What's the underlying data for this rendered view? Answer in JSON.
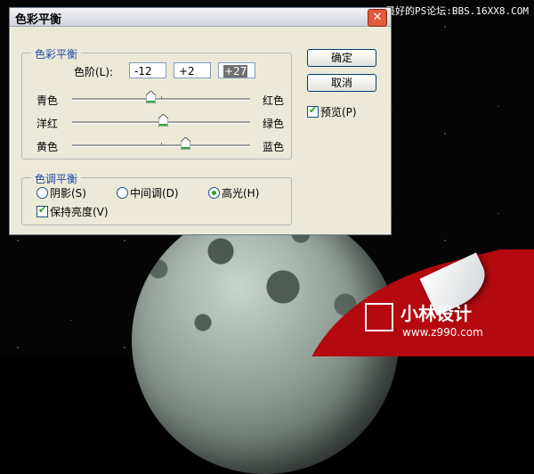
{
  "watermark_top": "最好的PS论坛:BBS.16XX8.COM",
  "logo": {
    "name": "小林设计",
    "url": "www.z990.com"
  },
  "dialog": {
    "title": "色彩平衡",
    "close_symbol": "✕",
    "color_balance_group": {
      "title": "色彩平衡",
      "levels_label": "色阶(L):",
      "levels": [
        "-12",
        "+2",
        "+27"
      ],
      "sliders": [
        {
          "left": "青色",
          "right": "红色",
          "value": -12
        },
        {
          "left": "洋红",
          "right": "绿色",
          "value": 2
        },
        {
          "left": "黄色",
          "right": "蓝色",
          "value": 27
        }
      ]
    },
    "tone_balance_group": {
      "title": "色调平衡",
      "options": [
        "阴影(S)",
        "中间调(D)",
        "高光(H)"
      ],
      "selected": "高光(H)",
      "preserve_luminosity": {
        "label": "保持亮度(V)",
        "checked": true
      }
    },
    "buttons": {
      "ok": "确定",
      "cancel": "取消"
    },
    "preview": {
      "label": "预览(P)",
      "checked": true
    }
  }
}
